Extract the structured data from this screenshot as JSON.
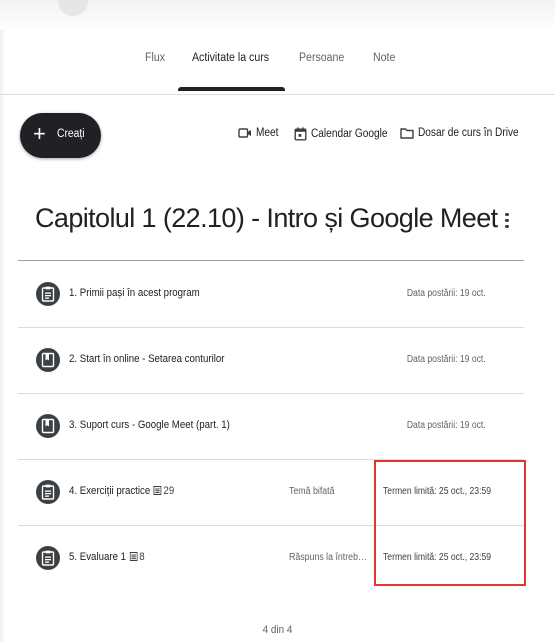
{
  "tabs": [
    {
      "label": "Flux",
      "active": false
    },
    {
      "label": "Activitate la curs",
      "active": true
    },
    {
      "label": "Persoane",
      "active": false
    },
    {
      "label": "Note",
      "active": false
    }
  ],
  "toolbar": {
    "create_label": "Creați",
    "meet_label": "Meet",
    "calendar_label": "Calendar Google",
    "drive_label": "Dosar de curs în Drive"
  },
  "topic": {
    "title": "Capitolul 1 (22.10) - Intro și Google Meet"
  },
  "items": [
    {
      "title": "1. Primii pași în acest program",
      "count": "",
      "status": "",
      "date": "Data postării: 19 oct.",
      "icon": "material-icon"
    },
    {
      "title": "2. Start în online - Setarea conturilor",
      "count": "",
      "status": "",
      "date": "Data postării: 19 oct.",
      "icon": "bookmark-icon"
    },
    {
      "title": "3. Suport curs - Google Meet (part. 1)",
      "count": "",
      "status": "",
      "date": "Data postării: 19 oct.",
      "icon": "bookmark-icon"
    },
    {
      "title": "4. Exerciții practice",
      "count": "29",
      "status": "Temă bifată",
      "date": "Termen limită: 25 oct., 23:59",
      "icon": "assignment-icon"
    },
    {
      "title": "5. Evaluare 1",
      "count": "8",
      "status": "Răspuns la întreb…",
      "date": "Termen limită: 25 oct., 23:59",
      "icon": "assignment-icon"
    }
  ],
  "pager": "4 din 4",
  "colors": {
    "highlight": "#e2352c",
    "dark": "#202124"
  }
}
